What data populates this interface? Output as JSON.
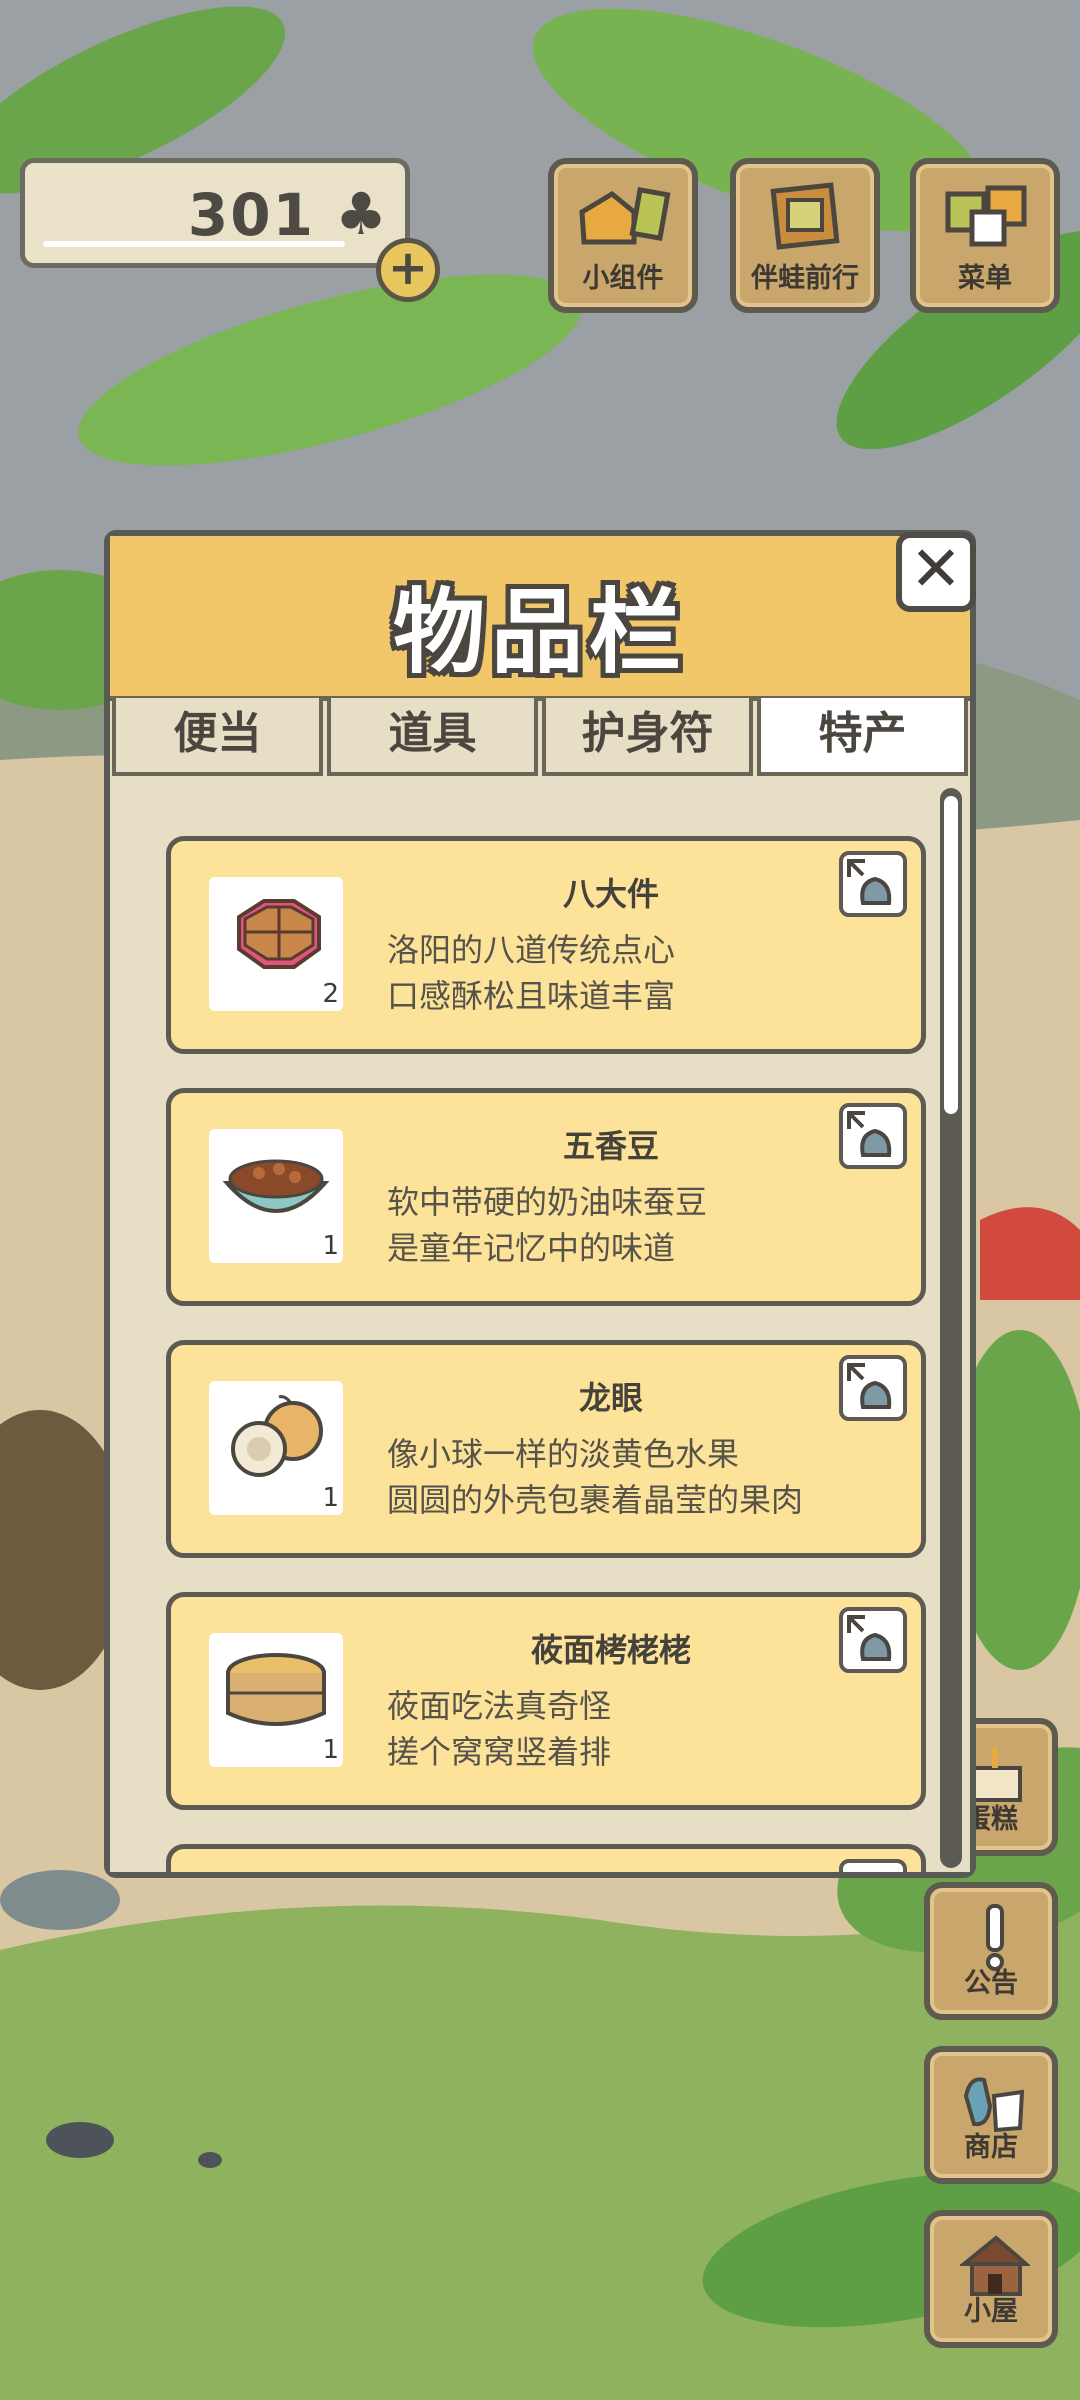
{
  "hud": {
    "clover_count": "301",
    "clover_symbol": "♣",
    "add_label": "+"
  },
  "top_buttons": [
    {
      "label": "小组件",
      "icon": "widget-icon"
    },
    {
      "label": "伴蛙前行",
      "icon": "photo-album-icon"
    },
    {
      "label": "菜单",
      "icon": "menu-cards-icon"
    }
  ],
  "side_buttons": [
    {
      "label": "蛋糕",
      "icon": "cake-icon"
    },
    {
      "label": "公告",
      "icon": "exclamation-icon"
    },
    {
      "label": "商店",
      "icon": "shop-bag-icon"
    },
    {
      "label": "小屋",
      "icon": "house-icon"
    }
  ],
  "panel": {
    "title": "物品栏",
    "close_label": "✕",
    "tabs": [
      {
        "label": "便当",
        "active": false
      },
      {
        "label": "道具",
        "active": false
      },
      {
        "label": "护身符",
        "active": false
      },
      {
        "label": "特产",
        "active": true
      }
    ],
    "items": [
      {
        "name": "八大件",
        "desc1": "洛阳的八道传统点心",
        "desc2": "口感酥松且味道丰富",
        "qty": "2",
        "icon": "pastry-box-icon"
      },
      {
        "name": "五香豆",
        "desc1": "软中带硬的奶油味蚕豆",
        "desc2": "是童年记忆中的味道",
        "qty": "1",
        "icon": "bean-bowl-icon"
      },
      {
        "name": "龙眼",
        "desc1": "像小球一样的淡黄色水果",
        "desc2": "圆圆的外壳包裹着晶莹的果肉",
        "qty": "1",
        "icon": "longan-icon"
      },
      {
        "name": "莜面栲栳栳",
        "desc1": "莜面吃法真奇怪",
        "desc2": "搓个窝窝竖着排",
        "qty": "1",
        "icon": "steamer-icon"
      }
    ]
  },
  "colors": {
    "panel_header": "#f1c76a",
    "item_card": "#fde29a",
    "button_wood": "#c9a66b"
  }
}
